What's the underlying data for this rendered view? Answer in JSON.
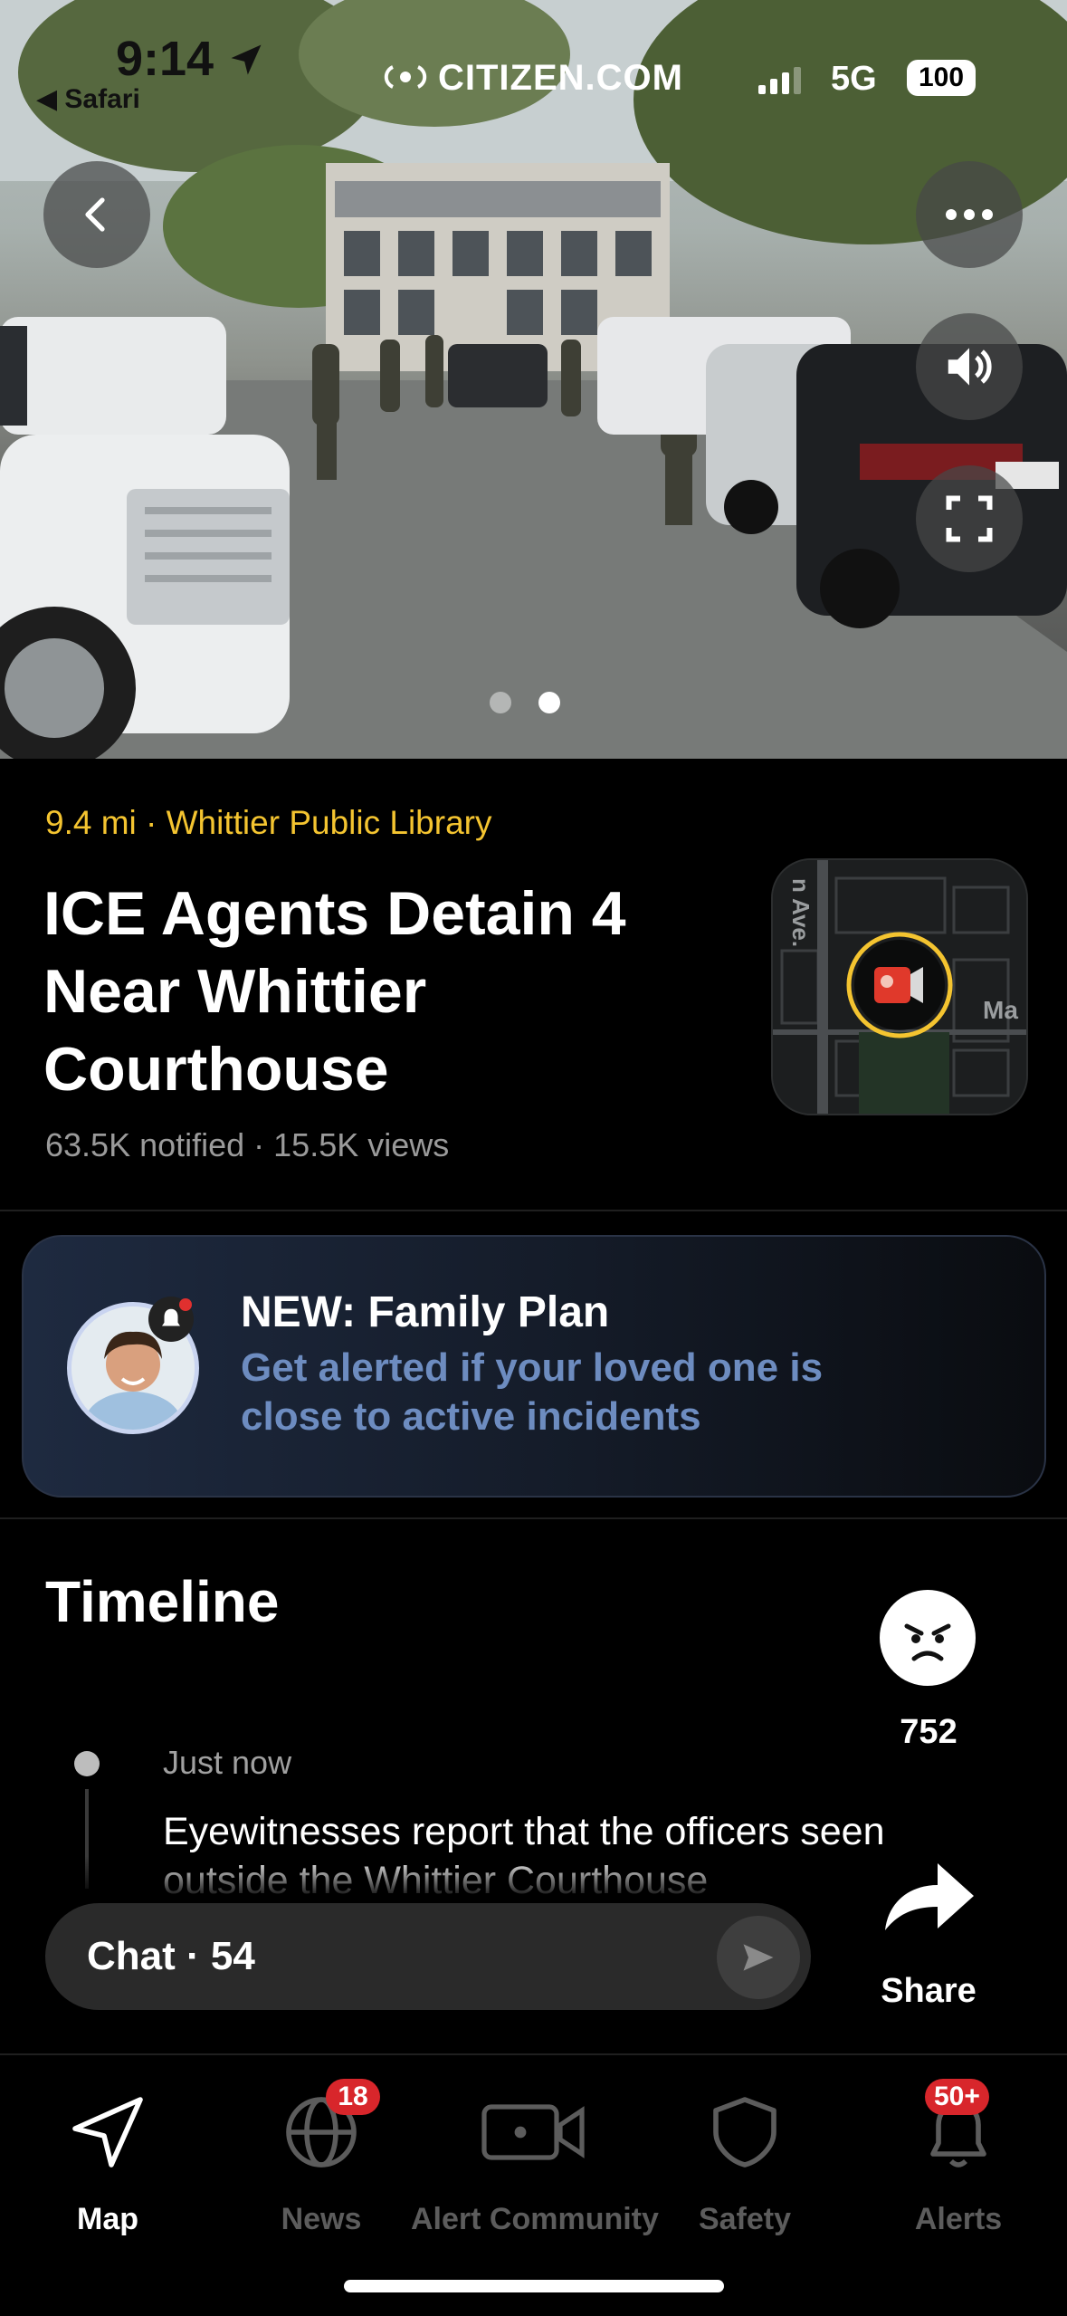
{
  "status_bar": {
    "time": "9:14",
    "back_app": "◀ Safari",
    "site": "CITIZEN.COM",
    "network": "5G",
    "battery": "100"
  },
  "media": {
    "page_count": 2,
    "current_page": 2
  },
  "incident": {
    "meta": "9.4 mi · Whittier Public Library",
    "title": "ICE Agents Detain 4 Near Whittier Courthouse",
    "stats": "63.5K notified · 15.5K views",
    "map_street_1": "n Ave.",
    "map_street_2": "Ma"
  },
  "promo": {
    "title": "NEW: Family Plan",
    "subtitle": "Get alerted if your loved one is close to active incidents"
  },
  "timeline": {
    "heading": "Timeline",
    "entries": [
      {
        "time": "Just now",
        "text": "Eyewitnesses report that the officers seen outside the Whittier Courthouse"
      }
    ]
  },
  "reaction": {
    "icon": "angry-face-icon",
    "count": "752"
  },
  "chat": {
    "label": "Chat · 54"
  },
  "share": {
    "label": "Share"
  },
  "tabs": [
    {
      "label": "Map",
      "icon": "navigation-arrow-icon",
      "active": true
    },
    {
      "label": "News",
      "icon": "globe-icon",
      "badge": "18"
    },
    {
      "label": "Alert Community",
      "icon": "video-camera-icon"
    },
    {
      "label": "Safety",
      "icon": "shield-icon"
    },
    {
      "label": "Alerts",
      "icon": "bell-icon",
      "badge": "50+"
    }
  ],
  "colors": {
    "accent_yellow": "#f4c430",
    "badge_red": "#d8262b",
    "promo_link": "#6d8cc0"
  }
}
